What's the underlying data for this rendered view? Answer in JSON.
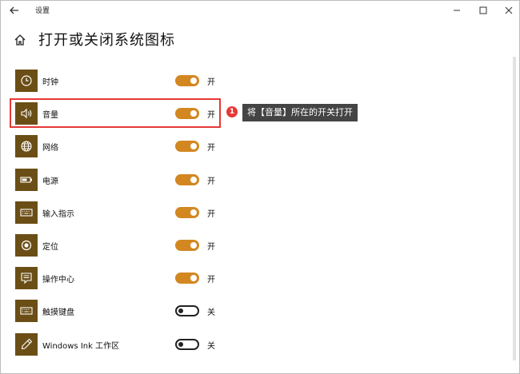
{
  "app": {
    "title": "设置",
    "page_title": "打开或关闭系统图标"
  },
  "window_controls": [
    "back-icon",
    "minimize-icon",
    "maximize-icon",
    "close-icon"
  ],
  "colors": {
    "toggle_on": "#d38721",
    "icon_tile": "#6b4e16",
    "highlight": "#e53935",
    "callout_bg": "#444444"
  },
  "items": [
    {
      "label": "时钟",
      "state": "开",
      "on": true,
      "icon": "clock-icon"
    },
    {
      "label": "音量",
      "state": "开",
      "on": true,
      "icon": "volume-icon"
    },
    {
      "label": "网络",
      "state": "开",
      "on": true,
      "icon": "globe-icon"
    },
    {
      "label": "电源",
      "state": "开",
      "on": true,
      "icon": "battery-icon"
    },
    {
      "label": "输入指示",
      "state": "开",
      "on": true,
      "icon": "keyboard-icon"
    },
    {
      "label": "定位",
      "state": "开",
      "on": true,
      "icon": "location-icon"
    },
    {
      "label": "操作中心",
      "state": "开",
      "on": true,
      "icon": "action-center-icon"
    },
    {
      "label": "触摸键盘",
      "state": "关",
      "on": false,
      "icon": "keyboard-icon"
    },
    {
      "label": "Windows Ink 工作区",
      "state": "关",
      "on": false,
      "icon": "pen-icon"
    }
  ],
  "annotation": {
    "step": "1",
    "text": "将【音量】所在的开关打开"
  }
}
